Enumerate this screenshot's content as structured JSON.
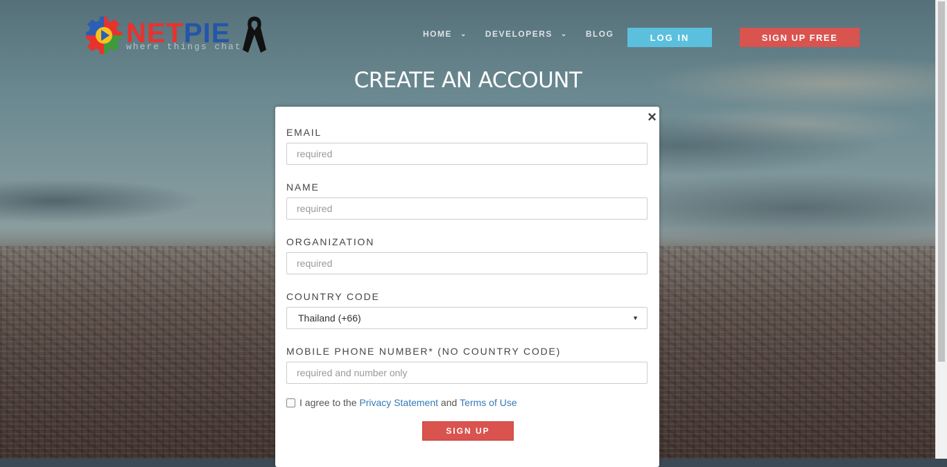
{
  "header": {
    "logo": {
      "text_net": "NET",
      "text_pie": "PIE",
      "tagline": "where things chat"
    },
    "nav": [
      {
        "label": "HOME",
        "has_dropdown": true
      },
      {
        "label": "DEVELOPERS",
        "has_dropdown": true
      },
      {
        "label": "BLOG",
        "has_dropdown": false
      }
    ],
    "login_label": "LOG IN",
    "signup_label": "SIGN UP FREE"
  },
  "page": {
    "title": "CREATE AN ACCOUNT"
  },
  "form": {
    "close_glyph": "×",
    "email": {
      "label": "EMAIL",
      "placeholder": "required",
      "value": ""
    },
    "name": {
      "label": "NAME",
      "placeholder": "required",
      "value": ""
    },
    "organization": {
      "label": "ORGANIZATION",
      "placeholder": "required",
      "value": ""
    },
    "country_code": {
      "label": "COUNTRY CODE",
      "selected": "Thailand (+66)"
    },
    "mobile": {
      "label": "MOBILE PHONE NUMBER* (NO COUNTRY CODE)",
      "placeholder": "required and number only",
      "value": ""
    },
    "agree": {
      "prefix": "I agree to the",
      "privacy_link": "Privacy Statement",
      "and": "and",
      "terms_link": "Terms of Use",
      "checked": false
    },
    "submit_label": "SIGN UP"
  },
  "colors": {
    "login_button": "#5bc0de",
    "signup_button": "#d9534f",
    "link": "#337ab7"
  },
  "icons": {
    "logo": "netpie-gear-logo-icon",
    "ribbon": "mourning-ribbon-icon",
    "close": "close-icon",
    "chevron": "chevron-down-icon",
    "select_arrow": "caret-down-icon"
  }
}
